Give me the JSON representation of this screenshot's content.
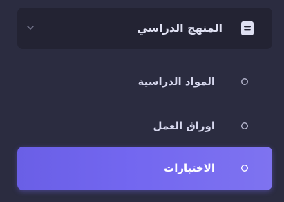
{
  "menu": {
    "header": {
      "label": "المنهج الدراسي",
      "icon": "book-icon",
      "expanded": true
    },
    "items": [
      {
        "label": "المواد الدراسية",
        "icon": "circle-bullet-icon",
        "active": false
      },
      {
        "label": "اوراق العمل",
        "icon": "circle-bullet-icon",
        "active": false
      },
      {
        "label": "الاختبارات",
        "icon": "circle-bullet-icon",
        "active": true
      }
    ]
  },
  "colors": {
    "background": "#2b2c40",
    "header_background": "#232333",
    "active_accent": "#7367f0",
    "text": "#d7d8ee",
    "active_text": "#ffffff"
  }
}
